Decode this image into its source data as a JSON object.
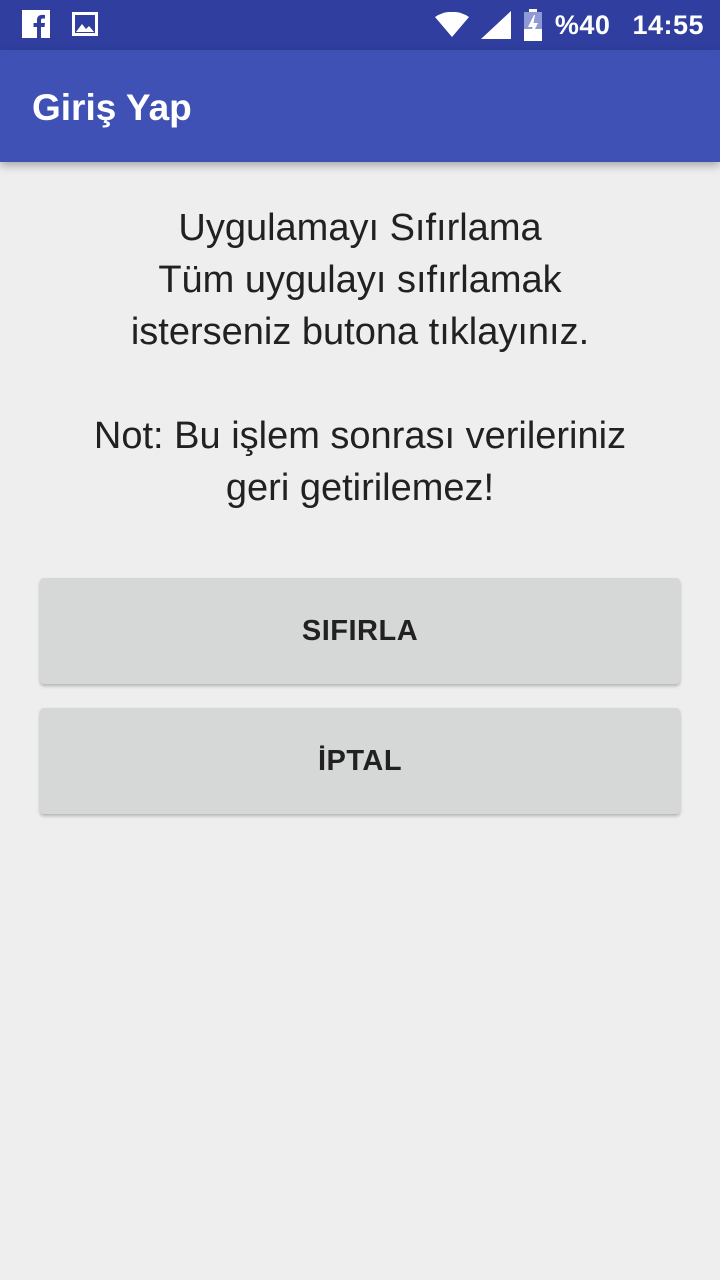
{
  "status_bar": {
    "left_icons": [
      "facebook-icon",
      "image-icon"
    ],
    "right_icons": [
      "wifi-icon",
      "signal-icon",
      "battery-charging-icon"
    ],
    "battery_text": "%40",
    "time": "14:55",
    "color": "#303f9f"
  },
  "app_bar": {
    "title": "Giriş Yap",
    "color": "#3f51b5"
  },
  "main": {
    "message": "Uygulamayı Sıfırlama\nTüm uygulayı sıfırlamak\nisterseniz butona tıklayınız.\n\nNot: Bu işlem sonrası verileriniz\ngeri getirilemez!",
    "reset_button_label": "SIFIRLA",
    "cancel_button_label": "İPTAL"
  }
}
